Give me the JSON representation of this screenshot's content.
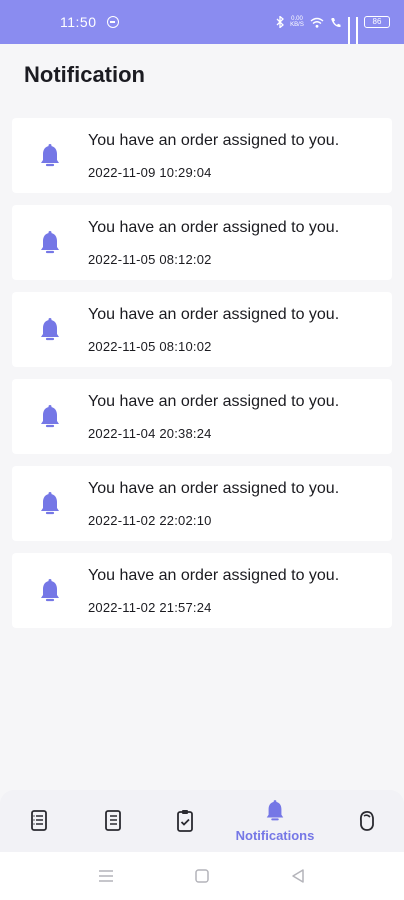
{
  "status_bar": {
    "time": "11:50",
    "network_speed": "0.00 KB/S",
    "battery": "86"
  },
  "page": {
    "title": "Notification"
  },
  "notifications": [
    {
      "icon": "bell-icon",
      "message": "You have an order assigned to you.",
      "time": "2022-11-09 10:29:04"
    },
    {
      "icon": "bell-icon",
      "message": "You have an order assigned to you.",
      "time": "2022-11-05 08:12:02"
    },
    {
      "icon": "bell-icon",
      "message": "You have an order assigned to you.",
      "time": "2022-11-05 08:10:02"
    },
    {
      "icon": "bell-icon",
      "message": "You have an order assigned to you.",
      "time": "2022-11-04 20:38:24"
    },
    {
      "icon": "bell-icon",
      "message": "You have an order assigned to you.",
      "time": "2022-11-02 22:02:10"
    },
    {
      "icon": "bell-icon",
      "message": "You have an order assigned to you.",
      "time": "2022-11-02 21:57:24"
    }
  ],
  "bottom_nav": {
    "items": [
      {
        "icon": "document-list-icon"
      },
      {
        "icon": "document-icon"
      },
      {
        "icon": "clipboard-check-icon"
      },
      {
        "icon": "bell-icon",
        "label": "Notifications",
        "active": true
      },
      {
        "icon": "hand-icon"
      }
    ]
  },
  "colors": {
    "accent": "#7577e6",
    "status_bar": "#8a8cf0",
    "background": "#f6f6f8",
    "card": "#ffffff"
  }
}
